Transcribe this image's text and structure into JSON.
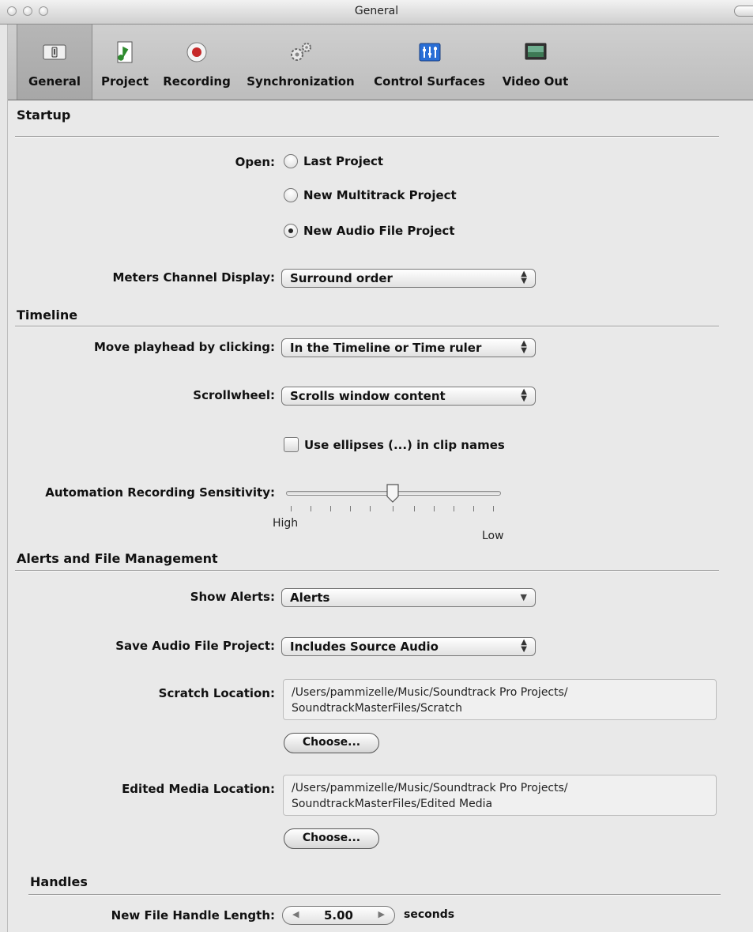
{
  "window": {
    "title": "General"
  },
  "toolbar": {
    "items": [
      {
        "label": "General",
        "icon": "general-switch-icon",
        "selected": true
      },
      {
        "label": "Project",
        "icon": "music-note-document-icon",
        "selected": false
      },
      {
        "label": "Recording",
        "icon": "record-icon",
        "selected": false
      },
      {
        "label": "Synchronization",
        "icon": "gears-icon",
        "selected": false
      },
      {
        "label": "Control Surfaces",
        "icon": "mixer-faders-icon",
        "selected": false
      },
      {
        "label": "Video Out",
        "icon": "monitor-icon",
        "selected": false
      }
    ]
  },
  "startup": {
    "title": "Startup",
    "open_label": "Open:",
    "options": [
      "Last Project",
      "New Multitrack Project",
      "New Audio File Project"
    ],
    "selected_option": "New Audio File Project",
    "meters_label": "Meters Channel Display:",
    "meters_value": "Surround order"
  },
  "timeline": {
    "title": "Timeline",
    "move_label": "Move playhead by clicking:",
    "move_value": "In the Timeline or Time ruler",
    "scroll_label": "Scrollwheel:",
    "scroll_value": "Scrolls window content",
    "ellipses_label": "Use ellipses (...) in clip names",
    "ellipses_checked": false,
    "sensitivity_label": "Automation Recording Sensitivity:",
    "sensitivity_high": "High",
    "sensitivity_low": "Low",
    "sensitivity_level": 0.5
  },
  "alerts": {
    "title": "Alerts and File Management",
    "show_label": "Show Alerts:",
    "show_value": "Alerts",
    "save_label": "Save Audio File Project:",
    "save_value": "Includes Source Audio",
    "scratch_label": "Scratch Location:",
    "scratch_path_line1": "/Users/pammizelle/Music/Soundtrack Pro Projects/",
    "scratch_path_line2": "SoundtrackMasterFiles/Scratch",
    "edited_label": "Edited Media Location:",
    "edited_path_line1": "/Users/pammizelle/Music/Soundtrack Pro Projects/",
    "edited_path_line2": "SoundtrackMasterFiles/Edited Media",
    "choose_label": "Choose..."
  },
  "handles": {
    "title": "Handles",
    "length_label": "New File Handle Length:",
    "length_value": "5.00",
    "unit": "seconds"
  },
  "colors": {
    "window_bg": "#e9e9e9",
    "toolbar_bg": "#c6c6c6",
    "record_red": "#c62828"
  }
}
